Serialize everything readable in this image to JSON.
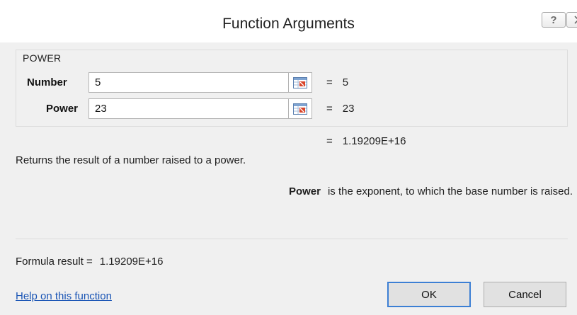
{
  "dialog": {
    "title": "Function Arguments",
    "help_button": "?",
    "close_icon": "close-icon"
  },
  "function": {
    "name": "POWER",
    "arguments": [
      {
        "label": "Number",
        "value": "5",
        "evaluated": "5"
      },
      {
        "label": "Power",
        "value": "23",
        "evaluated": "23"
      }
    ],
    "result_eq": "=",
    "result": "1.19209E+16",
    "description": "Returns the result of a number raised to a power.",
    "argument_help": {
      "name": "Power",
      "text": "is the exponent, to which the base number is raised."
    }
  },
  "footer": {
    "formula_label": "Formula result =",
    "formula_value": "1.19209E+16",
    "help_link": "Help on this function",
    "ok_label": "OK",
    "cancel_label": "Cancel"
  },
  "icons": {
    "ref_button": "collapse-dialog-icon"
  }
}
